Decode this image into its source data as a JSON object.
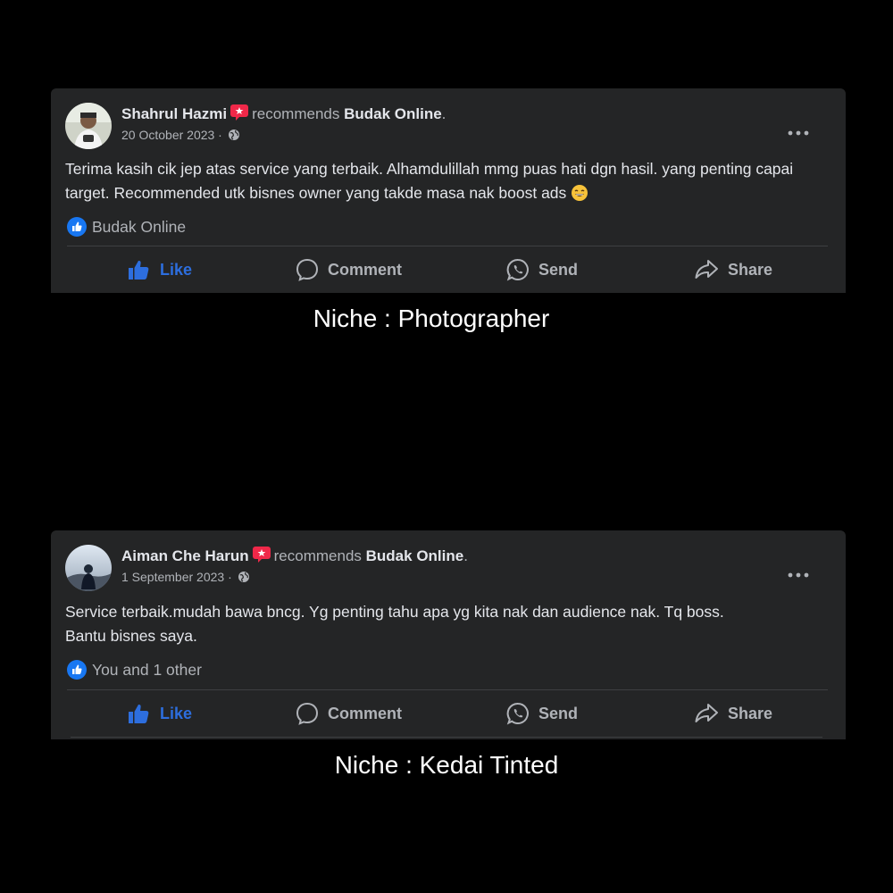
{
  "posts": [
    {
      "author": "Shahrul Hazmi",
      "verb": "recommends",
      "page": "Budak Online",
      "date": "20 October 2023 ·",
      "text": "Terima kasih cik jep atas service yang terbaik. Alhamdulillah mmg puas hati dgn hasil. yang penting capai target. Recommended utk bisnes owner yang takde masa nak boost ads",
      "emoji": "grinning-face-emoji",
      "reactions": "Budak Online",
      "actions": {
        "like": "Like",
        "comment": "Comment",
        "send": "Send",
        "share": "Share"
      }
    },
    {
      "author": "Aiman Che Harun",
      "verb": "recommends",
      "page": "Budak Online",
      "date": "1 September 2023 ·",
      "text_line1": "Service terbaik.mudah bawa bncg. Yg penting tahu apa yg kita nak dan audience nak. Tq boss.",
      "text_line2": "Bantu bisnes saya.",
      "reactions": "You and 1 other",
      "actions": {
        "like": "Like",
        "comment": "Comment",
        "send": "Send",
        "share": "Share"
      }
    }
  ],
  "captions": [
    "Niche : Photographer",
    "Niche : Kedai Tinted"
  ],
  "colors": {
    "background": "#000000",
    "card": "#242526",
    "text_primary": "#e4e6eb",
    "text_secondary": "#b0b3b8",
    "like_blue": "#2d6ede",
    "recommend_red": "#f02849"
  }
}
